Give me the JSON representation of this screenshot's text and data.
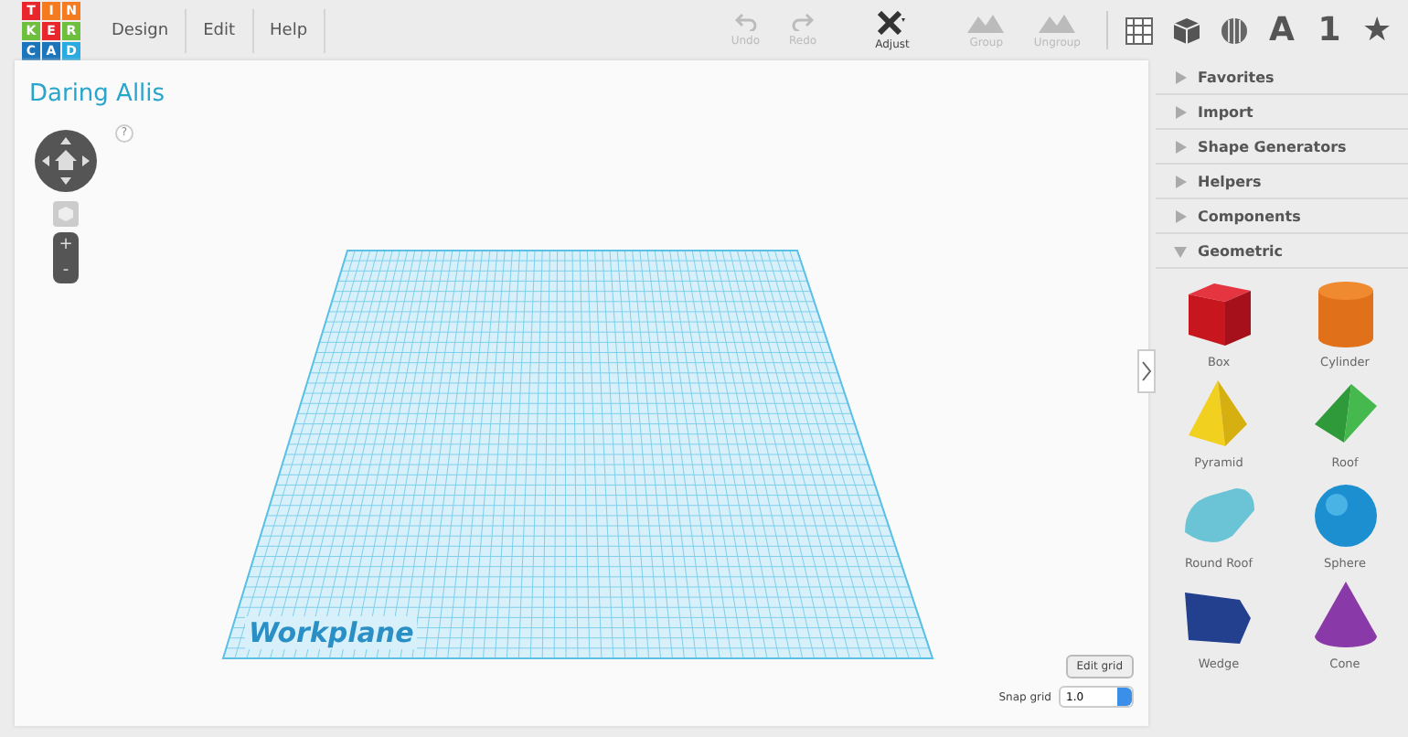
{
  "logo": [
    {
      "letter": "T",
      "color": "#e8262b"
    },
    {
      "letter": "I",
      "color": "#f47b20"
    },
    {
      "letter": "N",
      "color": "#f47b20"
    },
    {
      "letter": "K",
      "color": "#6dbf3d"
    },
    {
      "letter": "E",
      "color": "#e8262b"
    },
    {
      "letter": "R",
      "color": "#6dbf3d"
    },
    {
      "letter": "C",
      "color": "#1b75bb"
    },
    {
      "letter": "A",
      "color": "#1b75bb"
    },
    {
      "letter": "D",
      "color": "#29aae1"
    }
  ],
  "menu": [
    "Design",
    "Edit",
    "Help"
  ],
  "toolbar": [
    {
      "kind": "undo",
      "label": "Undo",
      "disabled": true
    },
    {
      "kind": "redo",
      "label": "Redo",
      "disabled": true
    },
    {
      "kind": "adjust",
      "label": "Adjust",
      "disabled": false
    },
    {
      "kind": "group",
      "label": "Group",
      "disabled": true
    },
    {
      "kind": "ungroup",
      "label": "Ungroup",
      "disabled": true
    }
  ],
  "view_icons": [
    {
      "kind": "grid"
    },
    {
      "kind": "box"
    },
    {
      "kind": "ball"
    },
    {
      "kind": "text",
      "label": "A"
    },
    {
      "kind": "text",
      "label": "1"
    },
    {
      "kind": "text",
      "label": "★"
    }
  ],
  "design_title": "Daring Allis",
  "help_label": "?",
  "zoom_buttons": [
    "+",
    "-"
  ],
  "workplane_label": "Workplane",
  "edit_grid": "Edit grid",
  "snap_grid": {
    "label": "Snap grid",
    "value": "1.0"
  },
  "sections": [
    {
      "label": "Favorites",
      "expanded": false
    },
    {
      "label": "Import",
      "expanded": false
    },
    {
      "label": "Shape Generators",
      "expanded": false
    },
    {
      "label": "Helpers",
      "expanded": false
    },
    {
      "label": "Components",
      "expanded": false
    },
    {
      "label": "Geometric",
      "expanded": true
    }
  ],
  "shapes": [
    {
      "kind": "box",
      "label": "Box"
    },
    {
      "kind": "cylinder",
      "label": "Cylinder"
    },
    {
      "kind": "pyramid",
      "label": "Pyramid"
    },
    {
      "kind": "roof",
      "label": "Roof"
    },
    {
      "kind": "roundroof",
      "label": "Round Roof"
    },
    {
      "kind": "sphere",
      "label": "Sphere"
    },
    {
      "kind": "wedge",
      "label": "Wedge"
    },
    {
      "kind": "cone",
      "label": "Cone"
    }
  ]
}
